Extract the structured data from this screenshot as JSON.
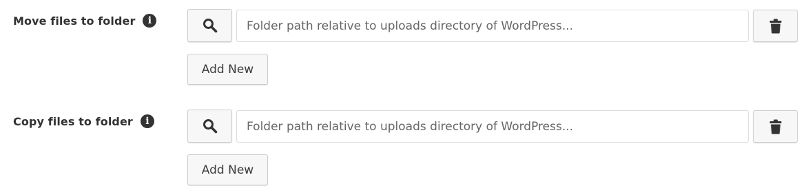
{
  "sections": [
    {
      "label": "Move files to folder",
      "info_icon": "info-circle-icon",
      "search_icon": "search-icon",
      "input": {
        "value": "",
        "placeholder": "Folder path relative to uploads directory of WordPress..."
      },
      "delete_icon": "trash-icon",
      "add_new_label": "Add New"
    },
    {
      "label": "Copy files to folder",
      "info_icon": "info-circle-icon",
      "search_icon": "search-icon",
      "input": {
        "value": "",
        "placeholder": "Folder path relative to uploads directory of WordPress..."
      },
      "delete_icon": "trash-icon",
      "add_new_label": "Add New"
    }
  ],
  "colors": {
    "text": "#333333",
    "button_bg": "#f7f7f7",
    "button_border": "#cccccc",
    "input_border": "#dddddd",
    "icon": "#333333"
  }
}
